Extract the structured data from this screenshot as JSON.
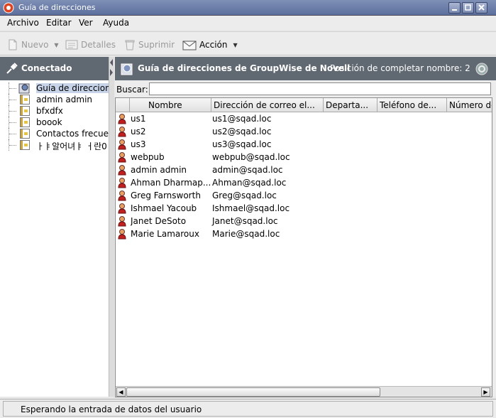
{
  "window": {
    "title": "Guía de direcciones"
  },
  "menubar": {
    "items": [
      "Archivo",
      "Editar",
      "Ver",
      "Ayuda"
    ]
  },
  "toolbar": {
    "new_label": "Nuevo",
    "details_label": "Detalles",
    "delete_label": "Suprimir",
    "action_label": "Acción"
  },
  "left_panel": {
    "header": "Conectado",
    "tree": [
      {
        "label": "Guía de direcciones",
        "selected": true
      },
      {
        "label": "admin admin"
      },
      {
        "label": "bfxdfx"
      },
      {
        "label": "boook"
      },
      {
        "label": "Contactos frecuentes"
      },
      {
        "label": "ㅏㅑ알어녀ㅑ ㅓ란0"
      }
    ]
  },
  "right_panel": {
    "header_title": "Guía de direcciones de GroupWise de Novell",
    "completion_position": "Posición de completar nombre: 2",
    "search_label": "Buscar:",
    "search_value": "",
    "columns": [
      "Nombre",
      "Dirección de correo el...",
      "Departa...",
      "Teléfono de...",
      "Número de"
    ],
    "rows": [
      {
        "name": "us1",
        "email": "us1@sqad.loc"
      },
      {
        "name": "us2",
        "email": "us2@sqad.loc"
      },
      {
        "name": "us3",
        "email": "us3@sqad.loc"
      },
      {
        "name": "webpub",
        "email": "webpub@sqad.loc"
      },
      {
        "name": "admin admin",
        "email": "admin@sqad.loc"
      },
      {
        "name": "Ahman Dharmap...",
        "email": "Ahman@sqad.loc"
      },
      {
        "name": "Greg Farnsworth",
        "email": "Greg@sqad.loc"
      },
      {
        "name": "Ishmael Yacoub",
        "email": "Ishmael@sqad.loc"
      },
      {
        "name": "Janet DeSoto",
        "email": "Janet@sqad.loc"
      },
      {
        "name": "Marie Lamaroux",
        "email": "Marie@sqad.loc"
      }
    ]
  },
  "statusbar": {
    "text": "Esperando la entrada de datos del usuario"
  }
}
